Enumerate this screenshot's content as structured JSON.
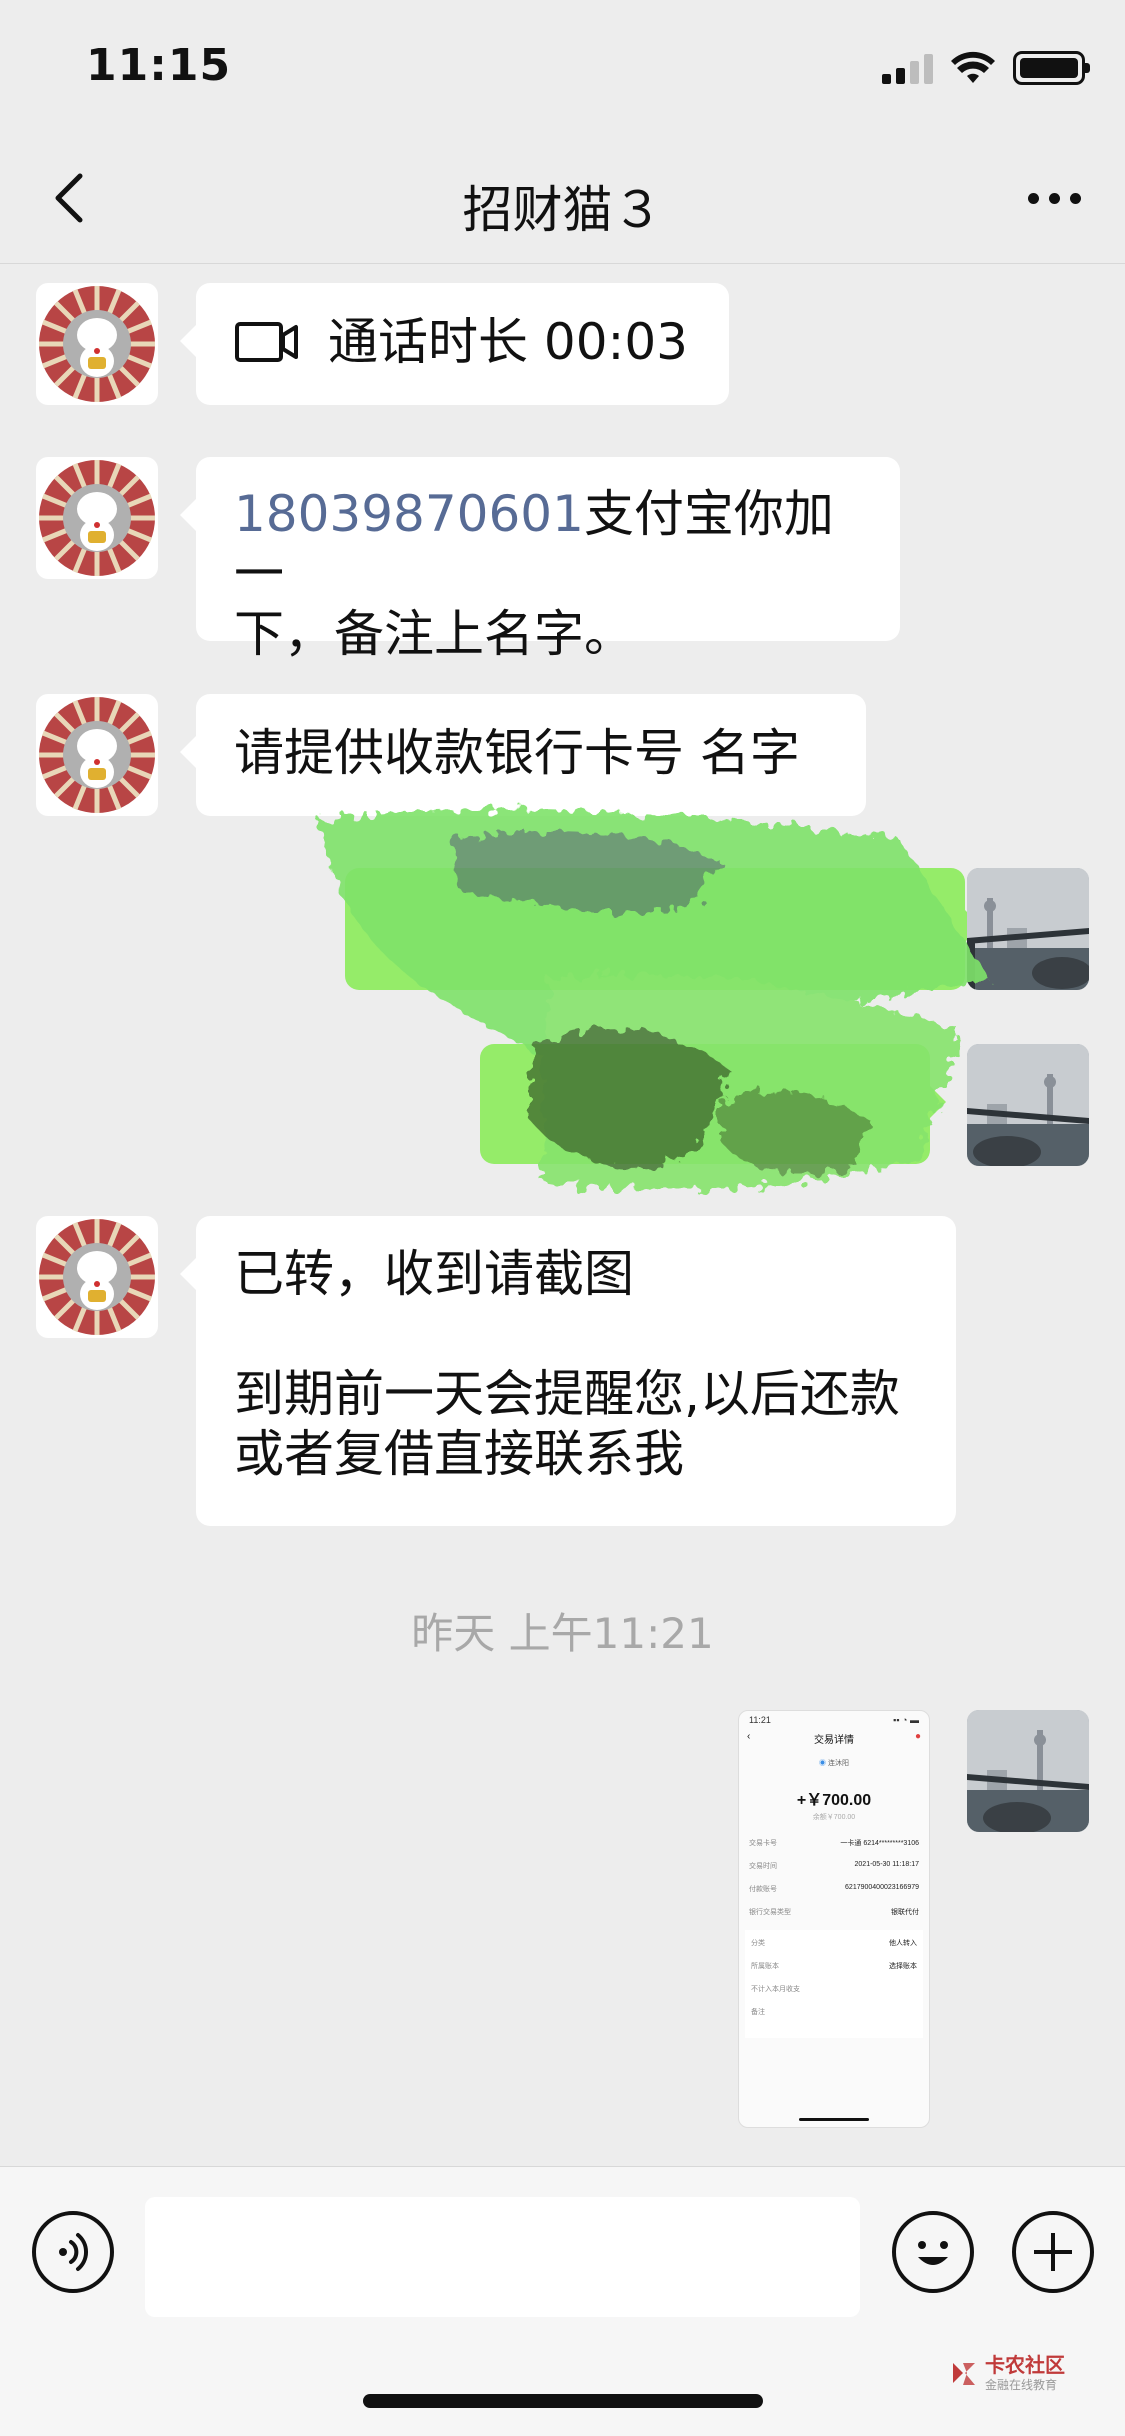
{
  "status_bar": {
    "time": "11:15"
  },
  "nav": {
    "title": "招财猫３"
  },
  "messages": {
    "call": {
      "text": "通话时长 00:03"
    },
    "alipay": {
      "phone": "18039870601",
      "text": "支付宝你加一下，备注上名字。",
      "line2": "下，备注上名字。",
      "line1_rest": "支付宝你加一"
    },
    "bank": {
      "text": "请提供收款银行卡号 名字"
    },
    "transferred": {
      "line1": "已转，收到请截图",
      "line2": "到期前一天会提醒您,以后还款",
      "line3": "或者复借直接联系我"
    }
  },
  "timestamp": "昨天 上午11:21",
  "image_message": {
    "status_time": "11:21",
    "header": "交易详情",
    "payee": "连沐阳",
    "amount": "+￥700.00",
    "sub": "余额￥700.00",
    "rows": [
      {
        "label": "交易卡号",
        "value": "一卡通 6214*********3106"
      },
      {
        "label": "交易时间",
        "value": "2021-05-30 11:18:17"
      },
      {
        "label": "付款账号",
        "value": "6217900400023166979"
      },
      {
        "label": "银行交易类型",
        "value": "银联代付"
      }
    ],
    "rows2": [
      {
        "label": "分类",
        "value": "他人转入"
      },
      {
        "label": "所属账本",
        "value": "选择账本"
      },
      {
        "label": "不计入本月收支",
        "value": ""
      },
      {
        "label": "备注",
        "value": ""
      }
    ]
  },
  "watermark": {
    "title": "卡农社区",
    "sub": "金融在线教育"
  },
  "colors": {
    "background": "#ededed",
    "bubble_self": "#95ec69",
    "link": "#576b95"
  }
}
